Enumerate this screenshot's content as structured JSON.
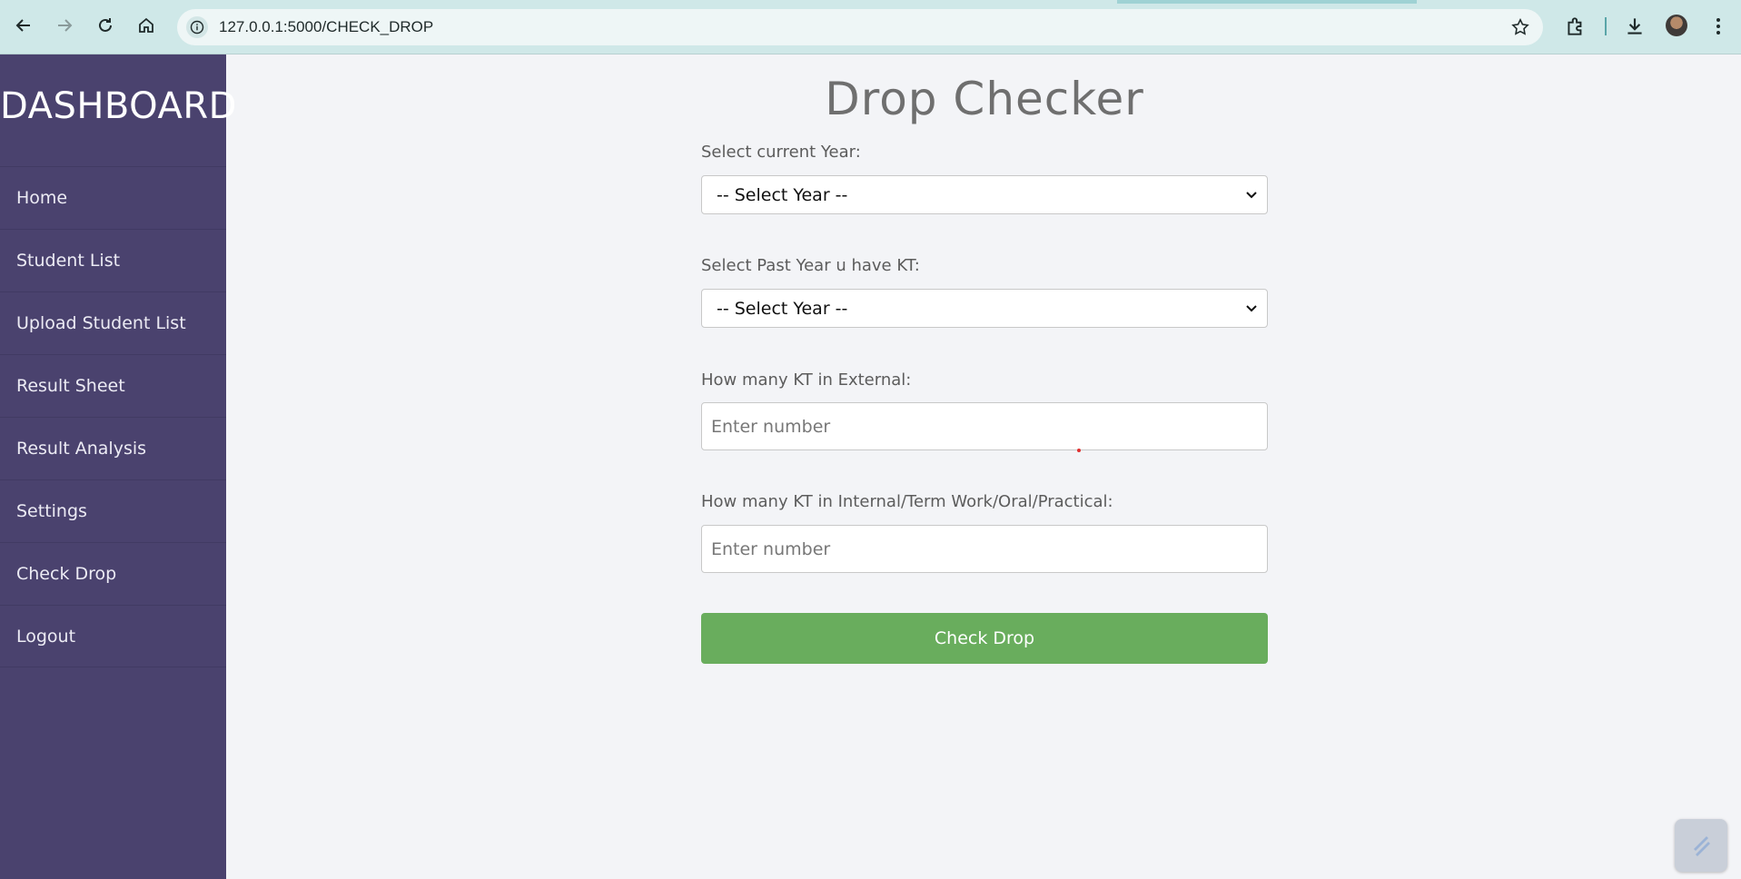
{
  "browser": {
    "url": "127.0.0.1:5000/CHECK_DROP",
    "icons": {
      "back": "arrow-left-icon",
      "forward": "arrow-right-icon",
      "reload": "reload-icon",
      "home": "home-icon",
      "info": "info-icon",
      "bookmark": "star-icon",
      "extensions": "puzzle-icon",
      "downloads": "download-icon",
      "menu": "kebab-menu-icon"
    }
  },
  "sidebar": {
    "brand": "DASHBOARD",
    "items": [
      {
        "label": "Home"
      },
      {
        "label": "Student List"
      },
      {
        "label": "Upload Student List"
      },
      {
        "label": "Result Sheet"
      },
      {
        "label": "Result Analysis"
      },
      {
        "label": "Settings"
      },
      {
        "label": "Check Drop"
      },
      {
        "label": "Logout"
      }
    ]
  },
  "form": {
    "title": "Drop Checker",
    "current_year": {
      "label": "Select current Year:",
      "value": "-- Select Year --"
    },
    "past_year": {
      "label": "Select Past Year u have KT:",
      "value": "-- Select Year --"
    },
    "external": {
      "label": "How many KT in External:",
      "placeholder": "Enter number"
    },
    "internal": {
      "label": "How many KT in Internal/Term Work/Oral/Practical:",
      "placeholder": "Enter number"
    },
    "submit_label": "Check Drop"
  },
  "colors": {
    "sidebar_bg": "#4a426e",
    "page_bg": "#f3f4f7",
    "button_green": "#69ad5d",
    "browser_chrome": "#cfe8e8"
  }
}
